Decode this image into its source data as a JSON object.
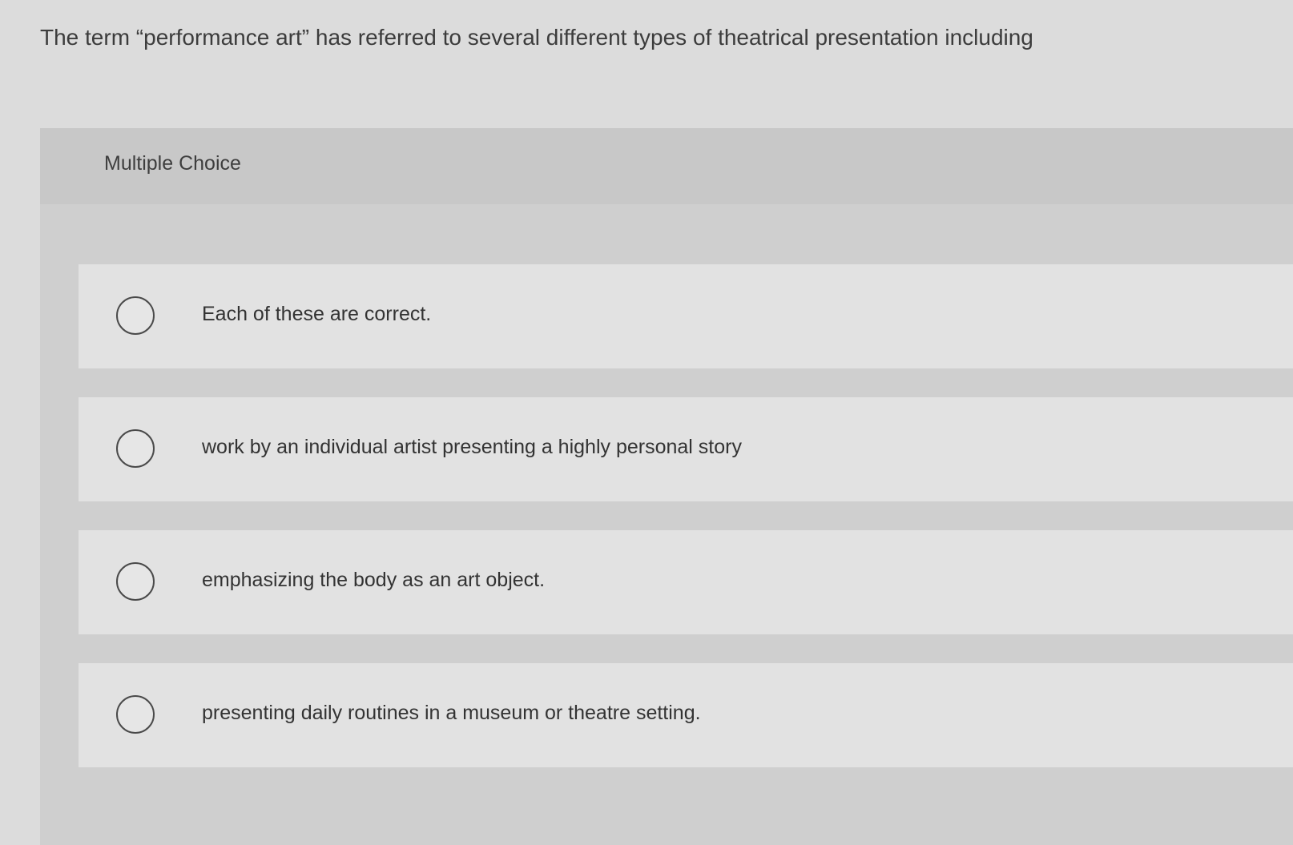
{
  "question": {
    "stem": "The term “performance art” has referred to several different types of theatrical presentation including"
  },
  "section": {
    "label": "Multiple Choice"
  },
  "choices": [
    {
      "label": "Each of these are correct.",
      "selected": false
    },
    {
      "label": "work by an individual artist presenting a highly personal story",
      "selected": false
    },
    {
      "label": "emphasizing the body as an art object.",
      "selected": false
    },
    {
      "label": "presenting daily routines in a museum or theatre setting.",
      "selected": false
    }
  ],
  "colors": {
    "background": "#dcdcdc",
    "panel": "#cfcfcf",
    "choice_background": "#e2e2e2",
    "text": "#333333",
    "radio_border": "#4a4a4a"
  },
  "icons": {
    "radio": "radio-unselected-icon"
  }
}
